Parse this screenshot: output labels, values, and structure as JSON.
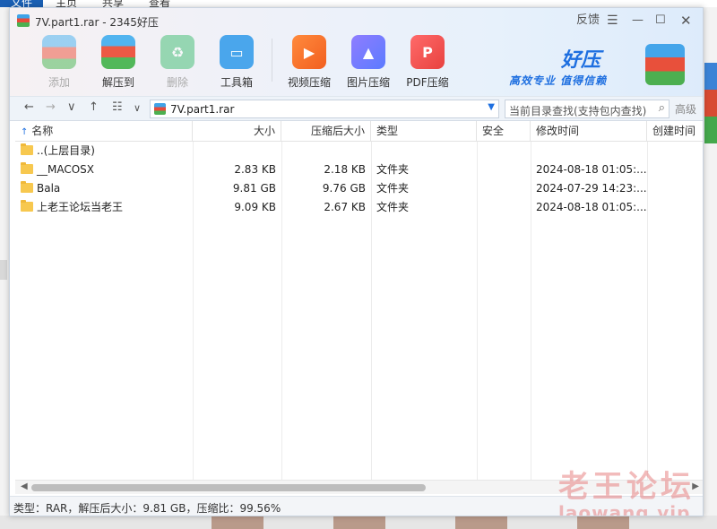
{
  "background": {
    "ribbon_tabs": [
      "文件",
      "主页",
      "共享",
      "查看"
    ]
  },
  "window": {
    "title": "7V.part1.rar - 2345好压",
    "feedback": "反馈",
    "menu_icon": "hamburger-icon",
    "controls": [
      "minimize-icon",
      "maximize-icon",
      "close-icon"
    ]
  },
  "toolbar": {
    "add": "添加",
    "extract": "解压到",
    "delete": "删除",
    "toolbox": "工具箱",
    "video": "视频压缩",
    "image": "图片压缩",
    "pdf": "PDF压缩"
  },
  "brand": {
    "name": "好压",
    "slogan": "高效专业 值得信赖"
  },
  "addressbar": {
    "path": "7V.part1.rar",
    "search_placeholder": "当前目录查找(支持包内查找)",
    "advanced": "高级"
  },
  "table": {
    "columns": [
      "名称",
      "大小",
      "压缩后大小",
      "类型",
      "安全",
      "修改时间",
      "创建时间"
    ],
    "rows": [
      {
        "name": "..(上层目录)",
        "size": "",
        "packed": "",
        "type": "",
        "safe": "",
        "modified": "",
        "created": ""
      },
      {
        "name": "__MACOSX",
        "size": "2.83 KB",
        "packed": "2.18 KB",
        "type": "文件夹",
        "safe": "",
        "modified": "2024-08-18 01:05:...",
        "created": ""
      },
      {
        "name": "Bala",
        "size": "9.81 GB",
        "packed": "9.76 GB",
        "type": "文件夹",
        "safe": "",
        "modified": "2024-07-29 14:23:...",
        "created": ""
      },
      {
        "name": "上老王论坛当老王",
        "size": "9.09 KB",
        "packed": "2.67 KB",
        "type": "文件夹",
        "safe": "",
        "modified": "2024-08-18 01:05:...",
        "created": ""
      }
    ]
  },
  "status": "类型：RAR，解压后大小：9.81 GB，压缩比：99.56%",
  "watermark": {
    "cn": "老王论坛",
    "en": "laowang.vip"
  }
}
